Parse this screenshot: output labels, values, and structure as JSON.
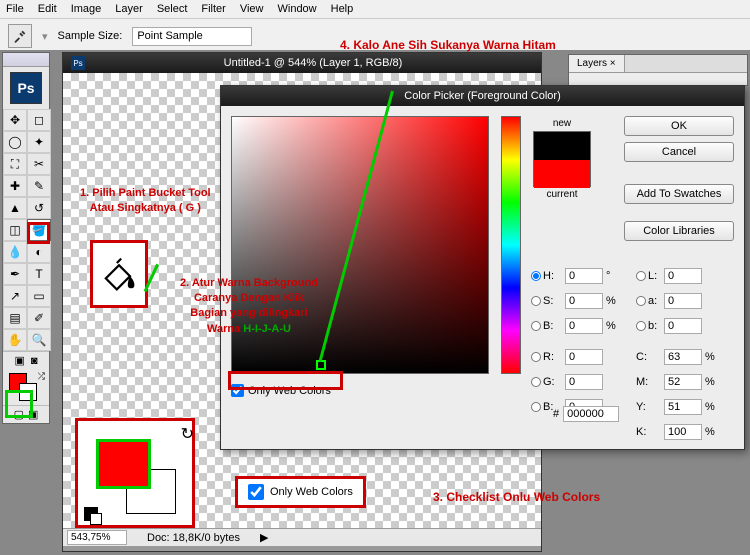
{
  "menu": {
    "file": "File",
    "edit": "Edit",
    "image": "Image",
    "layer": "Layer",
    "select": "Select",
    "filter": "Filter",
    "view": "View",
    "window": "Window",
    "help": "Help"
  },
  "options": {
    "sample_size_label": "Sample Size:",
    "sample_size_value": "Point Sample"
  },
  "doc": {
    "title": "Untitled-1 @ 544% (Layer 1, RGB/8)",
    "zoom": "543,75%",
    "docinfo": "Doc: 18,8K/0 bytes"
  },
  "layers": {
    "tab": "Layers ×"
  },
  "colorpicker": {
    "title": "Color Picker (Foreground Color)",
    "new": "new",
    "current": "current",
    "ok": "OK",
    "cancel": "Cancel",
    "add": "Add To Swatches",
    "libs": "Color Libraries",
    "H": "H:",
    "S": "S:",
    "B": "B:",
    "R": "R:",
    "G": "G:",
    "B2": "B:",
    "L": "L:",
    "a": "a:",
    "b": "b:",
    "C": "C:",
    "M": "M:",
    "Y": "Y:",
    "K": "K:",
    "Hv": "0",
    "Sv": "0",
    "Bv": "0",
    "Rv": "0",
    "Gv": "0",
    "B2v": "0",
    "Lv": "0",
    "av": "0",
    "bv": "0",
    "Cv": "63",
    "Mv": "52",
    "Yv": "51",
    "Kv": "100",
    "deg": "°",
    "pct": "%",
    "hex_label": "#",
    "hex": "000000",
    "only_web": "Only Web Colors"
  },
  "annotations": {
    "a1a": "1. Pilih Paint Bucket Tool",
    "a1b": "Atau Singkatnya ( G )",
    "a2a": "2. Atur Warna Background",
    "a2b": "Caranya Dengan Klik",
    "a2c": "Bagian yang dilingkari",
    "a2d": "Warna ",
    "a2e": "H-I-J-A-U",
    "a3": "3. Checklist Onlu Web Colors",
    "a4": "4. Kalo Ane Sih Sukanya Warna Hitam",
    "owc_big": "Only Web Colors"
  },
  "ps": "Ps"
}
